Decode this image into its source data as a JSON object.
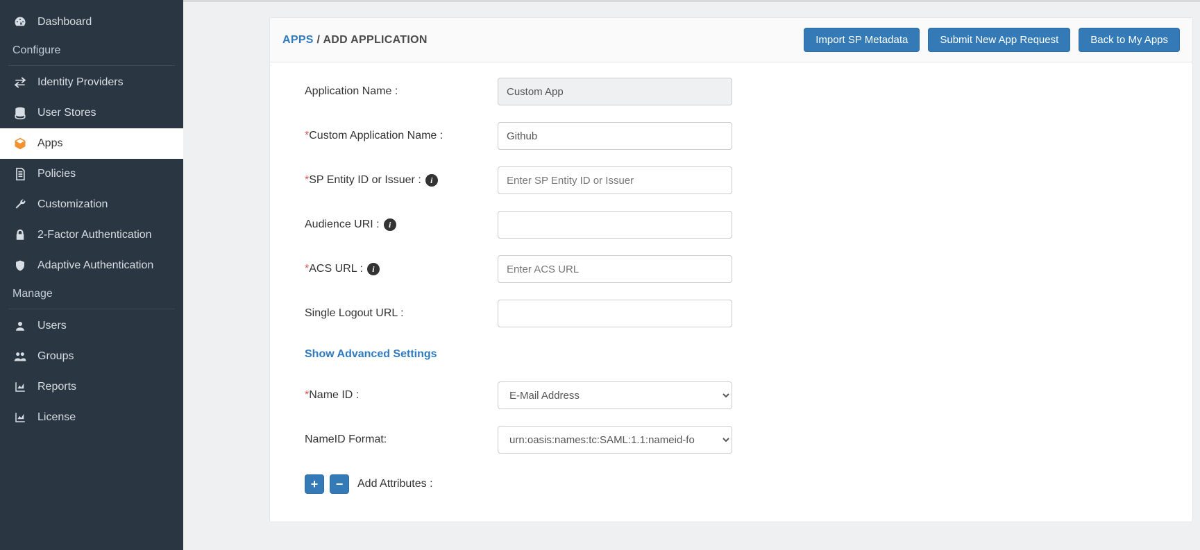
{
  "sidebar": {
    "dashboard": "Dashboard",
    "section_configure": "Configure",
    "identity_providers": "Identity Providers",
    "user_stores": "User Stores",
    "apps": "Apps",
    "policies": "Policies",
    "customization": "Customization",
    "two_factor": "2-Factor Authentication",
    "adaptive_auth": "Adaptive Authentication",
    "section_manage": "Manage",
    "users": "Users",
    "groups": "Groups",
    "reports": "Reports",
    "license": "License"
  },
  "breadcrumb": {
    "root": "APPS",
    "sep": "/",
    "leaf": "ADD APPLICATION"
  },
  "buttons": {
    "import_sp": "Import SP Metadata",
    "submit_request": "Submit New App Request",
    "back": "Back to My Apps"
  },
  "form": {
    "app_name_label": "Application Name :",
    "app_name_value": "Custom App",
    "custom_app_label": "Custom Application Name :",
    "custom_app_value": "Github",
    "sp_entity_label": "SP Entity ID or Issuer :",
    "sp_entity_placeholder": "Enter SP Entity ID or Issuer",
    "sp_entity_value": "",
    "audience_label": "Audience URI :",
    "audience_value": "",
    "acs_label": "ACS URL :",
    "acs_placeholder": "Enter ACS URL",
    "acs_value": "",
    "slo_label": "Single Logout URL :",
    "slo_value": "",
    "advanced_toggle": "Show Advanced Settings",
    "nameid_label": "Name ID :",
    "nameid_value": "E-Mail Address",
    "nameid_format_label": "NameID Format:",
    "nameid_format_value": "urn:oasis:names:tc:SAML:1.1:nameid-fo",
    "add_attributes_label": "Add Attributes :"
  }
}
